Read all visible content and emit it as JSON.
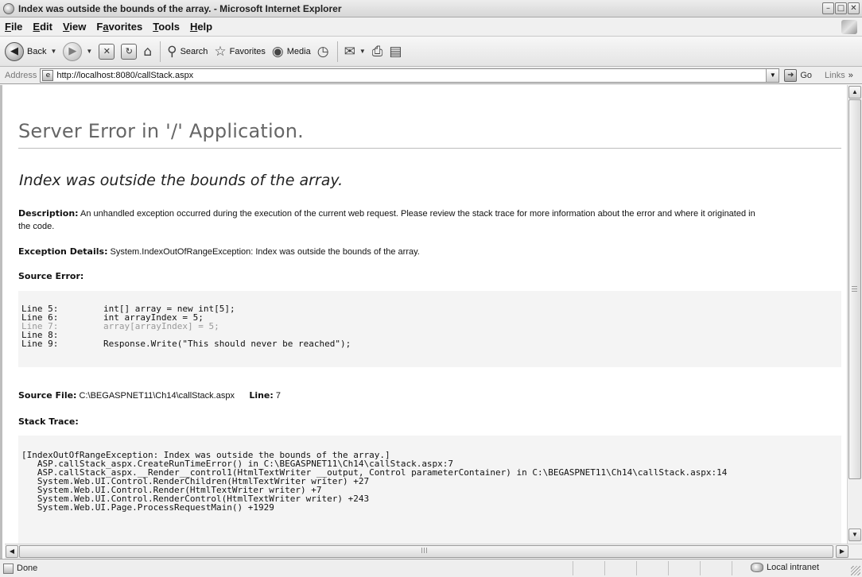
{
  "window": {
    "title": "Index was outside the bounds of the array. - Microsoft Internet Explorer",
    "buttons": [
      "minimize",
      "maximize",
      "close"
    ]
  },
  "menu": [
    {
      "underline": "F",
      "rest": "ile"
    },
    {
      "underline": "E",
      "rest": "dit"
    },
    {
      "underline": "V",
      "rest": "iew"
    },
    {
      "pre": "F",
      "underline": "a",
      "rest": "vorites"
    },
    {
      "underline": "T",
      "rest": "ools"
    },
    {
      "underline": "H",
      "rest": "elp"
    }
  ],
  "toolbar": {
    "back_label": "Back",
    "search_label": "Search",
    "favorites_label": "Favorites",
    "media_label": "Media"
  },
  "address": {
    "label": "Address",
    "url": "http://localhost:8080/callStack.aspx",
    "go_label": "Go",
    "links_label": "Links"
  },
  "page": {
    "server_title": "Server Error in '/' Application.",
    "error_heading": "Index was outside the bounds of the array.",
    "description_label": "Description:",
    "description_text": "An unhandled exception occurred during the execution of the current web request. Please review the stack trace for more information about the error and where it originated in",
    "description_text_2": "the code.",
    "exception_label": "Exception Details:",
    "exception_text": "System.IndexOutOfRangeException: Index was outside the bounds of the array.",
    "source_error_label": "Source Error:",
    "source_lines": [
      {
        "num": "Line 5:",
        "code": "int[] array = new int[5];"
      },
      {
        "num": "Line 6:",
        "code": "int arrayIndex = 5;"
      },
      {
        "num": "Line 7:",
        "code": "array[arrayIndex] = 5;"
      },
      {
        "num": "Line 8:",
        "code": ""
      },
      {
        "num": "Line 9:",
        "code": "Response.Write(\"This should never be reached\");"
      }
    ],
    "source_file_label": "Source File:",
    "source_file_path": "C:\\BEGASPNET11\\Ch14\\callStack.aspx",
    "line_label": "Line:",
    "line_number": "7",
    "stack_trace_label": "Stack Trace:",
    "stack_lines": [
      "[IndexOutOfRangeException: Index was outside the bounds of the array.]",
      "   ASP.callStack_aspx.CreateRunTimeError() in C:\\BEGASPNET11\\Ch14\\callStack.aspx:7",
      "   ASP.callStack_aspx.__Render__control1(HtmlTextWriter __output, Control parameterContainer) in C:\\BEGASPNET11\\Ch14\\callStack.aspx:14",
      "   System.Web.UI.Control.RenderChildren(HtmlTextWriter writer) +27",
      "   System.Web.UI.Control.Render(HtmlTextWriter writer) +7",
      "   System.Web.UI.Control.RenderControl(HtmlTextWriter writer) +243",
      "   System.Web.UI.Page.ProcessRequestMain() +1929"
    ]
  },
  "status": {
    "text": "Done",
    "zone": "Local intranet"
  },
  "colors": {
    "source_box_bg": "#f4f4f4",
    "highlight_line": "#999999",
    "title_gray": "#666666"
  }
}
